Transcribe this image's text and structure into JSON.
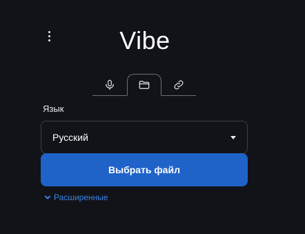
{
  "app": {
    "title": "Vibe"
  },
  "menu": {
    "icon": "kebab-menu-icon"
  },
  "tabs": [
    {
      "id": "record",
      "icon": "microphone-icon",
      "active": false
    },
    {
      "id": "file",
      "icon": "folder-icon",
      "active": true
    },
    {
      "id": "link",
      "icon": "link-icon",
      "active": false
    }
  ],
  "language": {
    "label": "Язык",
    "selected": "Русский"
  },
  "actions": {
    "choose_file_label": "Выбрать файл"
  },
  "advanced": {
    "label": "Расширенные"
  },
  "colors": {
    "background": "#111318",
    "primary_button": "#1f63c9",
    "link": "#3b82e6"
  }
}
